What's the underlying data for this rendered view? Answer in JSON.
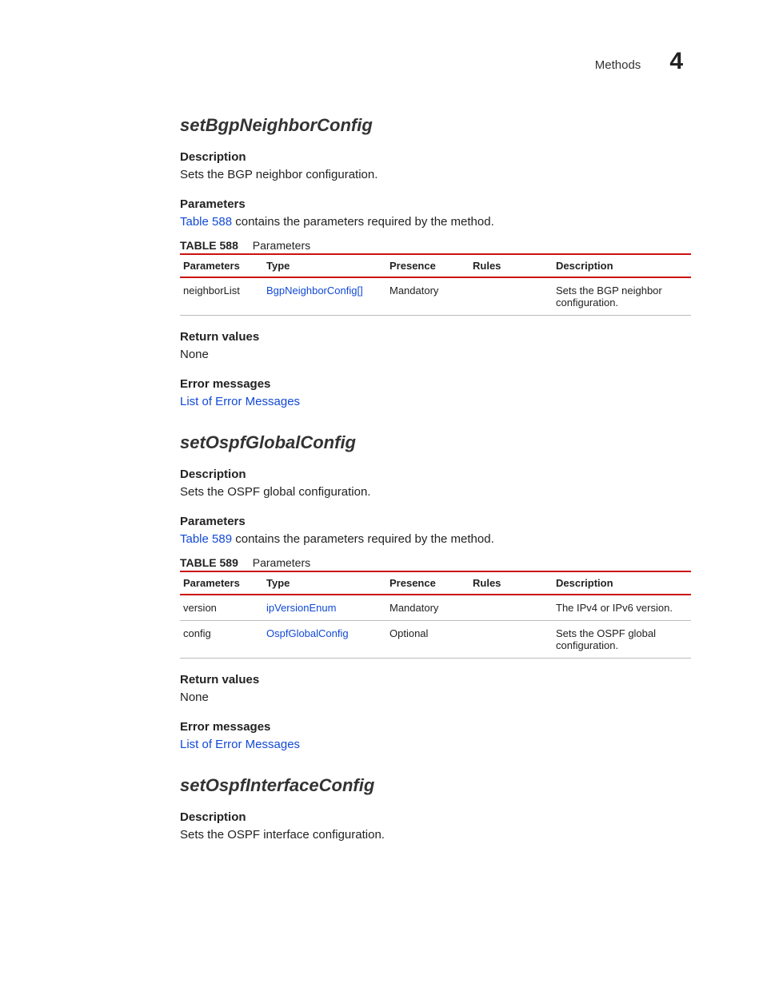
{
  "header": {
    "section": "Methods",
    "chapter": "4"
  },
  "labels": {
    "description": "Description",
    "parameters": "Parameters",
    "return_values": "Return values",
    "error_messages": "Error messages",
    "error_link": "List of Error Messages",
    "table_word": "TABLE",
    "table_caption": "Parameters",
    "cols": {
      "parameters": "Parameters",
      "type": "Type",
      "presence": "Presence",
      "rules": "Rules",
      "description": "Description"
    }
  },
  "methods": [
    {
      "title": "setBgpNeighborConfig",
      "description": "Sets the BGP neighbor configuration.",
      "param_intro_prefix": "Table 588",
      "param_intro_suffix": " contains the parameters required by the method.",
      "table_number": "588",
      "rows": [
        {
          "param": "neighborList",
          "type": "BgpNeighborConfig[]",
          "presence": "Mandatory",
          "rules": "",
          "desc": "Sets the BGP neighbor configuration."
        }
      ],
      "return_value": "None"
    },
    {
      "title": "setOspfGlobalConfig",
      "description": "Sets the OSPF global configuration.",
      "param_intro_prefix": "Table 589",
      "param_intro_suffix": " contains the parameters required by the method.",
      "table_number": "589",
      "rows": [
        {
          "param": "version",
          "type": "ipVersionEnum",
          "presence": "Mandatory",
          "rules": "",
          "desc": "The IPv4 or IPv6 version."
        },
        {
          "param": "config",
          "type": "OspfGlobalConfig",
          "presence": "Optional",
          "rules": "",
          "desc": "Sets the OSPF global configuration."
        }
      ],
      "return_value": "None"
    },
    {
      "title": "setOspfInterfaceConfig",
      "description": "Sets the OSPF interface configuration."
    }
  ]
}
